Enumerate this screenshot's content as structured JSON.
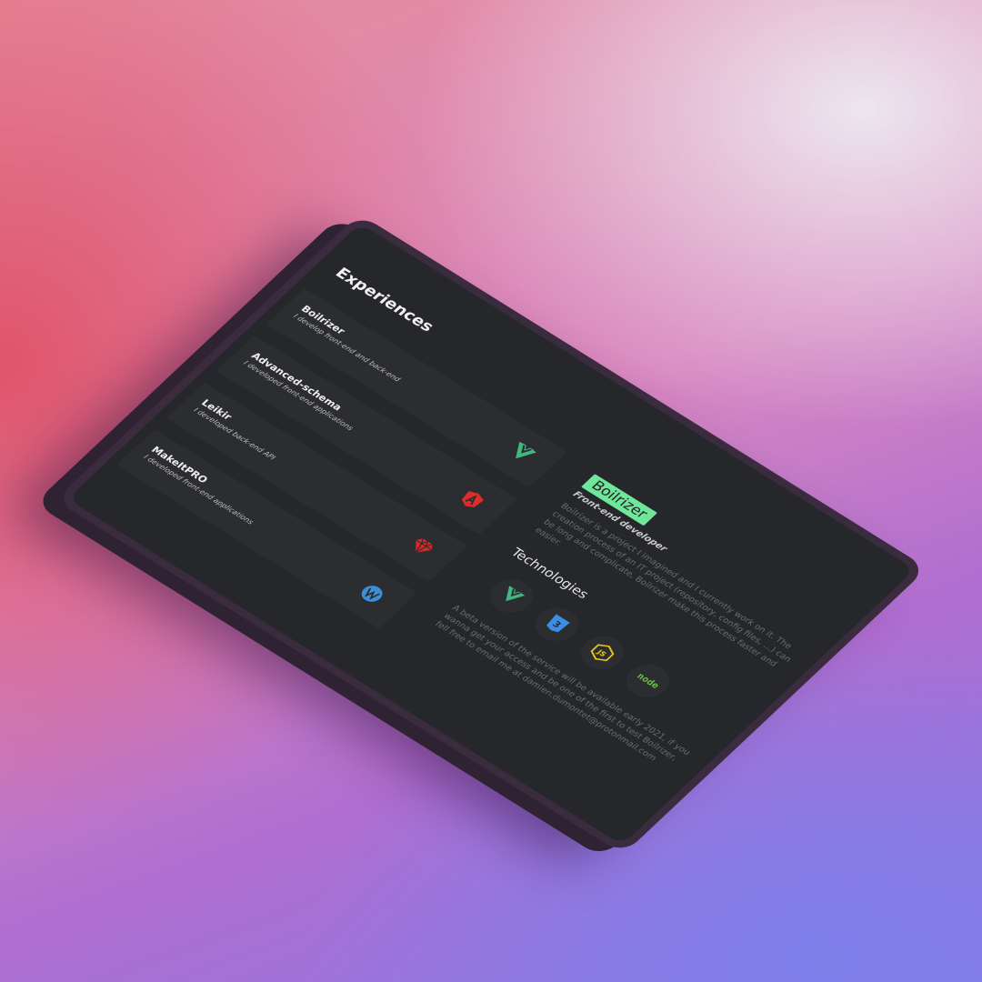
{
  "experiences": {
    "title": "Experiences",
    "items": [
      {
        "name": "Boilrizer",
        "desc": "I develop front-end and back-end",
        "icon": "vue-icon"
      },
      {
        "name": "Advanced-schema",
        "desc": "I developed front-end applications",
        "icon": "angular-icon"
      },
      {
        "name": "Leikir",
        "desc": "I developed back-end API",
        "icon": "ruby-icon"
      },
      {
        "name": "MakeItPRO",
        "desc": "I developed front-end applications",
        "icon": "wordpress-icon"
      }
    ]
  },
  "detail": {
    "badge": "Boilrizer",
    "role": "Front-end developer",
    "description": "Boilrizer is a project I imagined and I currently work on it. The creation process of an IT project (repository, config files, ...) can be long and complicate, Boilrizer make this process faster and easier.",
    "technologies_title": "Technologies",
    "technologies": [
      "vue-icon",
      "css3-icon",
      "nodejs-js-icon",
      "node-icon"
    ],
    "node_label": "node",
    "js_label": "JS",
    "css_label": "3",
    "beta": "A beta version of the service will be available early 2021, if you wanna get your access and be one of the first to test Boilrizer, fell free to email me at damien.dumontet@protonmail.com"
  },
  "colors": {
    "badge": "#6ee79a",
    "screen": "#26272b",
    "card": "#2c2d31"
  }
}
